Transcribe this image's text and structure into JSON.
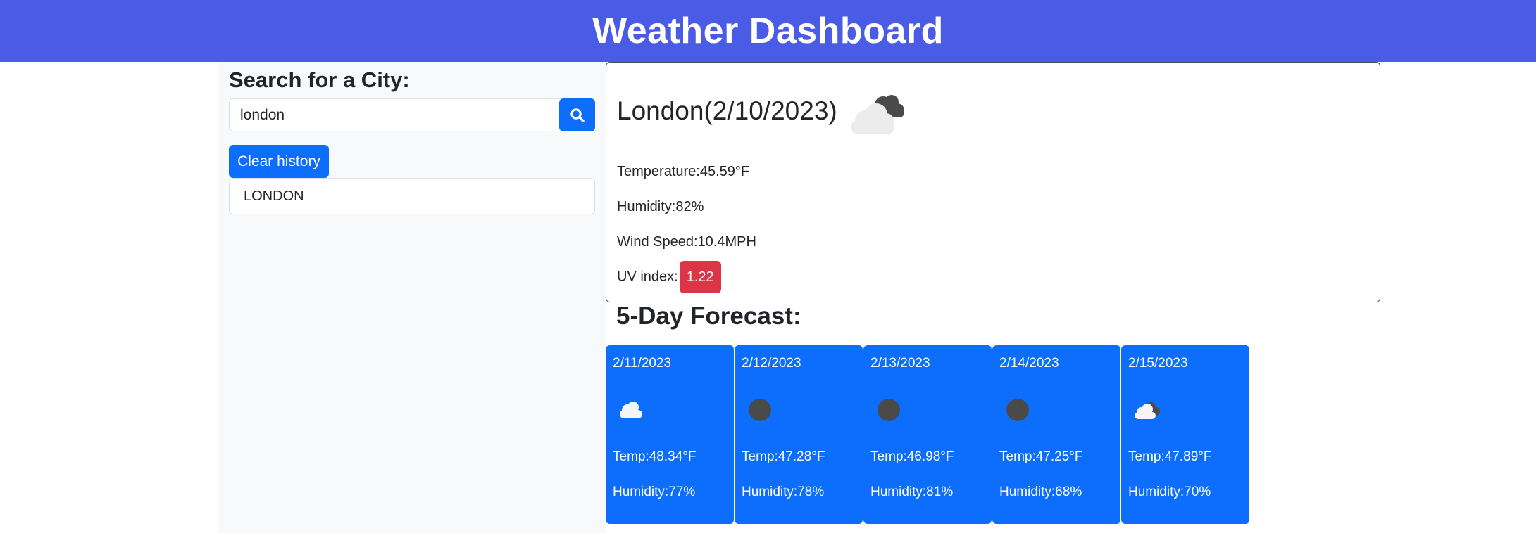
{
  "header": {
    "title": "Weather Dashboard"
  },
  "sidebar": {
    "title": "Search for a City:",
    "search": {
      "value": "london",
      "placeholder": ""
    },
    "clear_label": "Clear history",
    "history": [
      "LONDON"
    ]
  },
  "current": {
    "city_title": "London(2/10/2023)",
    "icon": "cloudy-icon",
    "temperature": "Temperature:45.59°F",
    "humidity": "Humidity:82%",
    "wind": "Wind Speed:10.4MPH",
    "uv_label": "UV index:",
    "uv_value": "1.22"
  },
  "forecast": {
    "title": "5-Day Forecast:",
    "days": [
      {
        "date": "2/11/2023",
        "icon": "cloud-icon",
        "temp": "Temp:48.34°F",
        "humidity": "Humidity:77%"
      },
      {
        "date": "2/12/2023",
        "icon": "dark-cloud-icon",
        "temp": "Temp:47.28°F",
        "humidity": "Humidity:78%"
      },
      {
        "date": "2/13/2023",
        "icon": "dark-cloud-icon",
        "temp": "Temp:46.98°F",
        "humidity": "Humidity:81%"
      },
      {
        "date": "2/14/2023",
        "icon": "dark-cloud-icon",
        "temp": "Temp:47.25°F",
        "humidity": "Humidity:68%"
      },
      {
        "date": "2/15/2023",
        "icon": "broken-clouds-icon",
        "temp": "Temp:47.89°F",
        "humidity": "Humidity:70%"
      }
    ]
  },
  "colors": {
    "header_bg": "#4a5be6",
    "primary": "#0d6efd",
    "uv_badge": "#dc3545",
    "sidebar_bg": "#f8f9fa"
  }
}
